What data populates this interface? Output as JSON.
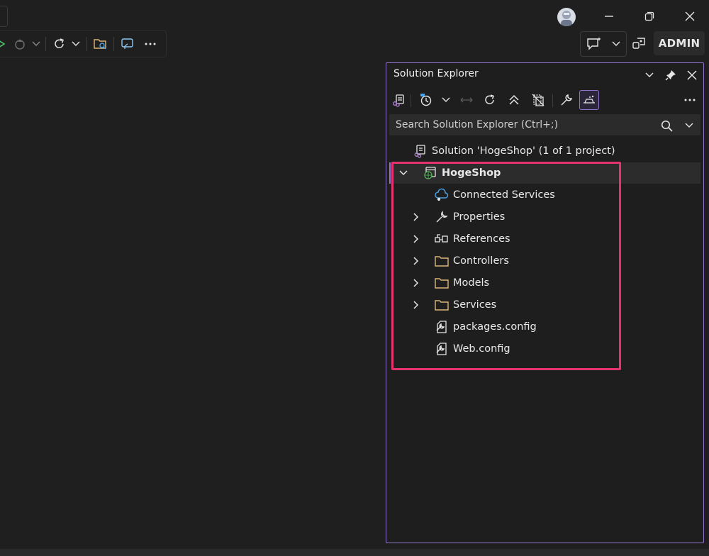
{
  "titlebar": {
    "icons": [
      "avatar",
      "minimize-icon",
      "restore-icon",
      "close-icon"
    ]
  },
  "toolbar": {
    "icons": [
      "run-icon",
      "hot-reload-icon",
      "chevron-down-icon",
      "refresh-icon",
      "chevron-down-icon",
      "folder-search-icon",
      "remote-icon",
      "more-icon"
    ],
    "right_icons": [
      "feedback-icon",
      "chevron-down-icon",
      "live-share-icon"
    ],
    "admin_label": "ADMIN"
  },
  "solution_explorer": {
    "title": "Solution Explorer",
    "search_placeholder": "Search Solution Explorer (Ctrl+;)",
    "toolbar_icons": [
      "switch-views-icon",
      "pending-changes-icon",
      "chevron-down-icon",
      "sync-icon",
      "refresh-icon",
      "collapse-all-icon",
      "show-all-files-icon",
      "properties-icon",
      "preview-icon",
      "more-icon"
    ],
    "solution_label": "Solution 'HogeShop' (1 of 1 project)",
    "project_label": "HogeShop",
    "items": [
      {
        "label": "Connected Services",
        "icon": "connected-services-icon",
        "expandable": false
      },
      {
        "label": "Properties",
        "icon": "wrench-icon",
        "expandable": true
      },
      {
        "label": "References",
        "icon": "references-icon",
        "expandable": true
      },
      {
        "label": "Controllers",
        "icon": "folder-icon",
        "expandable": true
      },
      {
        "label": "Models",
        "icon": "folder-icon",
        "expandable": true
      },
      {
        "label": "Services",
        "icon": "folder-icon",
        "expandable": true
      },
      {
        "label": "packages.config",
        "icon": "config-file-icon",
        "expandable": false
      },
      {
        "label": "Web.config",
        "icon": "config-file-icon",
        "expandable": false
      }
    ]
  },
  "colors": {
    "background": "#1f1f1f",
    "accent": "#8e75c9",
    "highlight_box": "#e5336e",
    "folder": "#dcb67a"
  }
}
